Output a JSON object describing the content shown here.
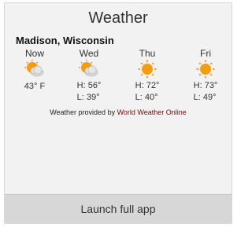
{
  "widget": {
    "title": "Weather",
    "location": "Madison, Wisconsin",
    "credit_prefix": "Weather provided by",
    "credit_link": "World Weather Online",
    "launch_label": "Launch full app"
  },
  "forecast": [
    {
      "day": "Now",
      "icon": "partly-cloudy-icon",
      "line1": "43° F",
      "line2": ""
    },
    {
      "day": "Wed",
      "icon": "partly-cloudy-icon",
      "line1": "H: 56°",
      "line2": "L: 39°"
    },
    {
      "day": "Thu",
      "icon": "sun-icon",
      "line1": "H: 72°",
      "line2": "L: 40°"
    },
    {
      "day": "Fri",
      "icon": "sun-icon",
      "line1": "H: 73°",
      "line2": "L: 49°"
    }
  ],
  "colors": {
    "sun": "#f39c12",
    "cloud": "#d9d9d9",
    "link": "#8b0000"
  }
}
